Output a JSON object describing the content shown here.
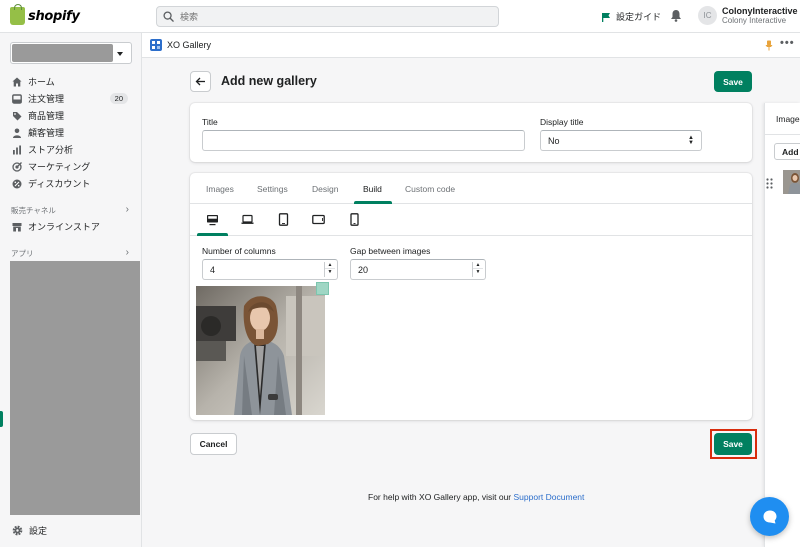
{
  "brand": {
    "logo_text": "shopify"
  },
  "topbar": {
    "search_placeholder": "検索",
    "guide_label": "設定ガイド",
    "avatar_initials": "IC",
    "user_name": "ColonyInteractive",
    "store_name": "Colony Interactive"
  },
  "sidebar": {
    "items": [
      {
        "label": "ホーム",
        "icon": "home-icon"
      },
      {
        "label": "注文管理",
        "icon": "orders-icon",
        "badge": "20"
      },
      {
        "label": "商品管理",
        "icon": "tag-icon"
      },
      {
        "label": "顧客管理",
        "icon": "person-icon"
      },
      {
        "label": "ストア分析",
        "icon": "analytics-icon"
      },
      {
        "label": "マーケティング",
        "icon": "marketing-icon"
      },
      {
        "label": "ディスカウント",
        "icon": "discount-icon"
      }
    ],
    "sales_channels_label": "販売チャネル",
    "online_store_label": "オンラインストア",
    "apps_label": "アプリ",
    "settings_label": "設定"
  },
  "app_header": {
    "app_name": "XO Gallery"
  },
  "page": {
    "title": "Add new gallery",
    "save_label": "Save",
    "cancel_label": "Cancel"
  },
  "form": {
    "title_label": "Title",
    "title_value": "",
    "display_title_label": "Display title",
    "display_title_value": "No"
  },
  "tabs": [
    {
      "label": "Images",
      "active": false
    },
    {
      "label": "Settings",
      "active": false
    },
    {
      "label": "Design",
      "active": false
    },
    {
      "label": "Build",
      "active": true
    },
    {
      "label": "Custom code",
      "active": false
    }
  ],
  "devices": [
    "desktop-icon",
    "laptop-icon",
    "tablet-icon",
    "tablet-landscape-icon",
    "mobile-icon"
  ],
  "build": {
    "columns_label": "Number of columns",
    "columns_value": "4",
    "gap_label": "Gap between images",
    "gap_value": "20"
  },
  "help": {
    "text": "For help with XO Gallery app, visit our",
    "link": "Support Document"
  },
  "side_panel": {
    "title": "Images",
    "add_label": "Add images"
  },
  "colors": {
    "primary": "#008060",
    "highlight": "#d82c0d",
    "link": "#2c6ecb",
    "chat": "#1f8ef1"
  }
}
